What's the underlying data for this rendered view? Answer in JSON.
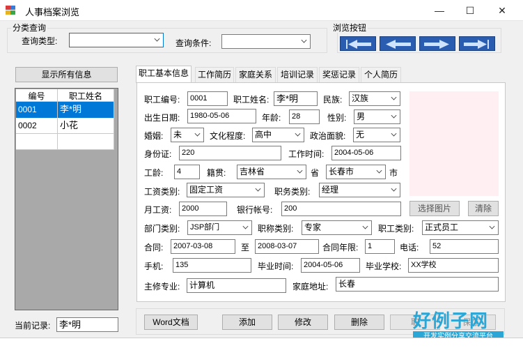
{
  "window": {
    "title": "人事档案浏览",
    "minimize": "—",
    "maximize": "☐",
    "close": "✕"
  },
  "filter": {
    "group_title": "分类查询",
    "type_label": "查询类型:",
    "type_value": "",
    "condition_label": "查询条件:",
    "condition_value": ""
  },
  "browse": {
    "group_title": "浏览按钮",
    "buttons": [
      "first",
      "previous",
      "next",
      "last"
    ]
  },
  "left": {
    "show_all_label": "显示所有信息",
    "columns": [
      "编号",
      "职工姓名"
    ],
    "rows": [
      {
        "id": "0001",
        "name": "李*明",
        "selected": true
      },
      {
        "id": "0002",
        "name": "小花",
        "selected": false
      }
    ],
    "current_label": "当前记录:",
    "current_value": "李*明"
  },
  "tabs": [
    "职工基本信息",
    "工作简历",
    "家庭关系",
    "培训记录",
    "奖惩记录",
    "个人简历"
  ],
  "form": {
    "emp_id_label": "职工编号:",
    "emp_id": "0001",
    "emp_name_label": "职工姓名:",
    "emp_name": "李*明",
    "ethnic_label": "民族:",
    "ethnic": "汉族",
    "birth_label": "出生日期:",
    "birth": "1980-05-06",
    "age_label": "年龄:",
    "age": "28",
    "gender_label": "性别:",
    "gender": "男",
    "marriage_label": "婚姻:",
    "marriage": "未",
    "education_label": "文化程度:",
    "education": "高中",
    "politics_label": "政治面貌:",
    "politics": "无",
    "idcard_label": "身份证:",
    "idcard": "220",
    "worktime_label": "工作时间:",
    "worktime": "2004-05-06",
    "seniority_label": "工龄:",
    "seniority": "4",
    "native_label": "籍贯:",
    "province": "吉林省",
    "province_suffix": "省",
    "city": "长春市",
    "city_suffix": "市",
    "wage_type_label": "工资类别:",
    "wage_type": "固定工资",
    "duty_type_label": "职务类别:",
    "duty_type": "经理",
    "salary_label": "月工资:",
    "salary": "2000",
    "bank_label": "银行帐号:",
    "bank": "200",
    "select_photo": "选择图片",
    "clear_photo": "清除",
    "dept_label": "部门类别:",
    "dept": "JSP部门",
    "title_type_label": "职称类别:",
    "title_type": "专家",
    "emp_type_label": "职工类别:",
    "emp_type": "正式员工",
    "contract_label": "合同:",
    "contract_start": "2007-03-08",
    "to_label": "至",
    "contract_end": "2008-03-07",
    "contract_years_label": "合同年限:",
    "contract_years": "1",
    "phone_label": "电话:",
    "phone": "52",
    "mobile_label": "手机:",
    "mobile": "135",
    "grad_time_label": "毕业时间:",
    "grad_time": "2004-05-06",
    "school_label": "毕业学校:",
    "school": "XX学校",
    "major_label": "主修专业:",
    "major": "计算机",
    "address_label": "家庭地址:",
    "address": "长春"
  },
  "actions": {
    "word": "Word文档",
    "add": "添加",
    "edit": "修改",
    "delete": "删除",
    "cancel": "取",
    "save": "保存"
  },
  "watermark": {
    "brand": "好例子网",
    "slogan": "开发实例分享交流平台"
  },
  "colors": {
    "selected_row": "#0078d7",
    "nav_button": "#2a5db0",
    "photo_bg": "#ffeef2"
  }
}
